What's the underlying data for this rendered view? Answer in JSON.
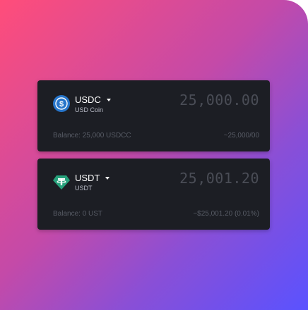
{
  "colors": {
    "card_bg": "#1c1e24",
    "usdc_icon": "#2775ca",
    "usdt_icon": "#26a17b"
  },
  "cards": [
    {
      "token_symbol": "USDC",
      "token_name": "USD Coin",
      "icon": "usdc-icon",
      "amount": "25,000.00",
      "balance": "Balance: 25,000 USDCC",
      "usd_value": "~25,000/00"
    },
    {
      "token_symbol": "USDT",
      "token_name": "USDT",
      "icon": "usdt-icon",
      "amount": "25,001.20",
      "balance": "Balance: 0 UST",
      "usd_value": "~$25,001.20 (0.01%)"
    }
  ]
}
